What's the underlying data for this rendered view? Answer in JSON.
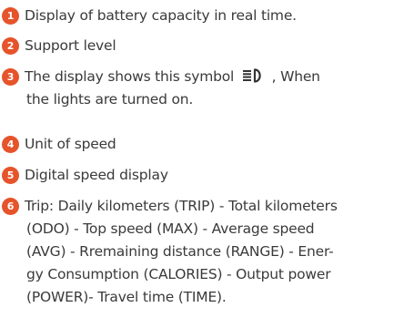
{
  "accent_color": "#e5542a",
  "items": [
    {
      "number": "1",
      "lines": [
        "Display of battery capacity in real time."
      ]
    },
    {
      "number": "2",
      "lines": [
        "Support level"
      ]
    },
    {
      "number": "3",
      "text_before": "The display shows this symbol",
      "symbol": "headlight-icon",
      "text_after": ", When",
      "lines": [
        "the lights are turned on."
      ]
    },
    {
      "number": "4",
      "lines": [
        "Unit of speed"
      ]
    },
    {
      "number": "5",
      "lines": [
        "Digital speed display"
      ]
    },
    {
      "number": "6",
      "lines": [
        "Trip: Daily kilometers (TRIP) - Total kilometers",
        "(ODO) - Top speed (MAX) - Average speed",
        "(AVG) - Rremaining distance (RANGE) - Ener-",
        "gy Consumption (CALORIES) - Output power",
        "(POWER)- Travel time (TIME)."
      ]
    }
  ]
}
